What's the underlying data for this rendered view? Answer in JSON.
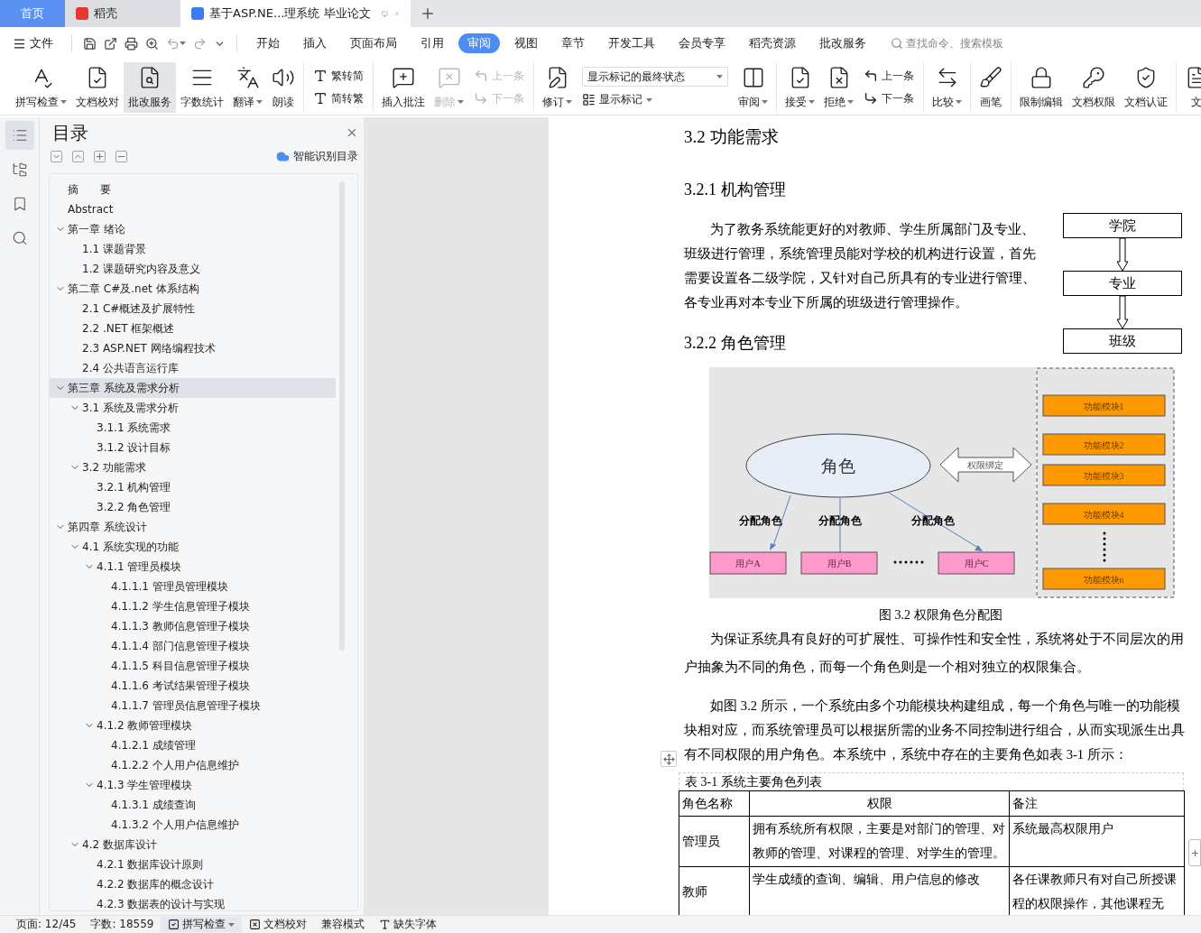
{
  "tabs": [
    {
      "label": "首页",
      "kind": "home",
      "selected": false
    },
    {
      "label": "稻壳",
      "kind": "docer",
      "selected": false
    },
    {
      "label": "基于ASP.NE...理系统 毕业论文",
      "kind": "doc",
      "selected": true
    }
  ],
  "menu": {
    "file": "文件",
    "tabs": [
      {
        "label": "开始",
        "selected": false
      },
      {
        "label": "插入",
        "selected": false
      },
      {
        "label": "页面布局",
        "selected": false
      },
      {
        "label": "引用",
        "selected": false
      },
      {
        "label": "审阅",
        "selected": true
      },
      {
        "label": "视图",
        "selected": false
      },
      {
        "label": "章节",
        "selected": false
      },
      {
        "label": "开发工具",
        "selected": false
      },
      {
        "label": "会员专享",
        "selected": false
      },
      {
        "label": "稻壳资源",
        "selected": false
      },
      {
        "label": "批改服务",
        "selected": false
      }
    ],
    "search": {
      "placeholder": "查找命令、搜索模板"
    }
  },
  "ribbon": [
    {
      "items": [
        {
          "kind": "large",
          "label": "拼写检查",
          "menu": true,
          "disabled": false,
          "active": false
        },
        {
          "kind": "large",
          "label": "文档校对",
          "menu": false,
          "disabled": false,
          "active": false
        },
        {
          "kind": "large",
          "label": "批改服务",
          "menu": false,
          "disabled": false,
          "active": true
        },
        {
          "kind": "large",
          "label": "字数统计",
          "menu": false,
          "disabled": false,
          "active": false
        },
        {
          "kind": "large",
          "label": "翻译",
          "menu": true,
          "disabled": false,
          "active": false
        },
        {
          "kind": "large",
          "label": "朗读",
          "menu": false,
          "disabled": false,
          "active": false
        }
      ]
    },
    {
      "items": [
        {
          "kind": "stack",
          "entries": [
            {
              "label": "繁转简",
              "disabled": false
            },
            {
              "label": "简转繁",
              "disabled": false
            }
          ]
        }
      ]
    },
    {
      "items": [
        {
          "kind": "large",
          "label": "插入批注",
          "menu": false,
          "disabled": false,
          "active": false
        },
        {
          "kind": "large",
          "label": "删除",
          "menu": true,
          "disabled": true,
          "active": false
        },
        {
          "kind": "stack",
          "entries": [
            {
              "label": "上一条",
              "disabled": true
            },
            {
              "label": "下一条",
              "disabled": true
            }
          ]
        }
      ]
    },
    {
      "items": [
        {
          "kind": "large",
          "label": "修订",
          "menu": true,
          "disabled": false,
          "active": false
        },
        {
          "kind": "select",
          "value": "显示标记的最终状态",
          "option": "显示标记"
        },
        {
          "kind": "large",
          "label": "审阅",
          "menu": true,
          "disabled": false,
          "active": false
        }
      ]
    },
    {
      "items": [
        {
          "kind": "large",
          "label": "接受",
          "menu": true,
          "disabled": false,
          "active": false
        },
        {
          "kind": "large",
          "label": "拒绝",
          "menu": true,
          "disabled": false,
          "active": false
        },
        {
          "kind": "stack",
          "entries": [
            {
              "label": "上一条",
              "disabled": false
            },
            {
              "label": "下一条",
              "disabled": false
            }
          ]
        }
      ]
    },
    {
      "items": [
        {
          "kind": "large",
          "label": "比较",
          "menu": true,
          "disabled": false,
          "active": false
        }
      ]
    },
    {
      "items": [
        {
          "kind": "large",
          "label": "画笔",
          "menu": false,
          "disabled": false,
          "active": false
        }
      ]
    },
    {
      "items": [
        {
          "kind": "large",
          "label": "限制编辑",
          "menu": false,
          "disabled": false,
          "active": false
        },
        {
          "kind": "large",
          "label": "文档权限",
          "menu": false,
          "disabled": false,
          "active": false
        },
        {
          "kind": "large",
          "label": "文档认证",
          "menu": false,
          "disabled": false,
          "active": false
        }
      ]
    },
    {
      "items": [
        {
          "kind": "large",
          "label": "文",
          "menu": false,
          "disabled": false,
          "active": false
        }
      ]
    }
  ],
  "rail": [
    {
      "selected": true
    },
    {
      "selected": false
    },
    {
      "selected": false
    },
    {
      "selected": false
    }
  ],
  "toc": {
    "title": "目录",
    "smart": "智能识别目录",
    "items": [
      {
        "label": "摘　　要",
        "selected": false
      },
      {
        "label": "Abstract",
        "selected": false
      },
      {
        "label": "第一章  绪论",
        "selected": false,
        "expanded": true,
        "children": [
          {
            "label": "1.1  课题背景",
            "selected": false
          },
          {
            "label": "1.2  课题研究内容及意义",
            "selected": false
          }
        ]
      },
      {
        "label": "第二章  C#及.net 体系结构",
        "selected": false,
        "expanded": true,
        "children": [
          {
            "label": "2.1 C#概述及扩展特性",
            "selected": false
          },
          {
            "label": "2.2    .NET 框架概述",
            "selected": false
          },
          {
            "label": "2.3 ASP.NET 网络编程技术",
            "selected": false
          },
          {
            "label": "2.4  公共语言运行库",
            "selected": false
          }
        ]
      },
      {
        "label": "第三章  系统及需求分析",
        "selected": true,
        "expanded": true,
        "children": [
          {
            "label": "3.1 系统及需求分析",
            "selected": false,
            "expanded": true,
            "children": [
              {
                "label": "3.1.1  系统需求",
                "selected": false
              },
              {
                "label": "3.1.2  设计目标",
                "selected": false
              }
            ]
          },
          {
            "label": "3.2  功能需求",
            "selected": false,
            "expanded": true,
            "children": [
              {
                "label": "3.2.1  机构管理",
                "selected": false
              },
              {
                "label": "3.2.2  角色管理",
                "selected": false
              }
            ]
          }
        ]
      },
      {
        "label": "第四章    系统设计",
        "selected": false,
        "expanded": true,
        "children": [
          {
            "label": "4.1  系统实现的功能",
            "selected": false,
            "expanded": true,
            "children": [
              {
                "label": "4.1.1 管理员模块",
                "selected": false,
                "expanded": true,
                "children": [
                  {
                    "label": "4.1.1.1 管理员管理模块",
                    "selected": false
                  },
                  {
                    "label": "4.1.1.2  学生信息管理子模块",
                    "selected": false
                  },
                  {
                    "label": "4.1.1.3  教师信息管理子模块",
                    "selected": false
                  },
                  {
                    "label": "4.1.1.4  部门信息管理子模块",
                    "selected": false
                  },
                  {
                    "label": "4.1.1.5  科目信息管理子模块",
                    "selected": false
                  },
                  {
                    "label": "4.1.1.6  考试结果管理子模块",
                    "selected": false
                  },
                  {
                    "label": "4.1.1.7  管理员信息管理子模块",
                    "selected": false
                  }
                ]
              },
              {
                "label": "4.1.2  教师管理模块",
                "selected": false,
                "expanded": true,
                "children": [
                  {
                    "label": "4.1.2.1  成绩管理",
                    "selected": false
                  },
                  {
                    "label": "4.1.2.2 个人用户信息维护",
                    "selected": false
                  }
                ]
              },
              {
                "label": "4.1.3  学生管理模块",
                "selected": false,
                "expanded": true,
                "children": [
                  {
                    "label": "4.1.3.1  成绩查询",
                    "selected": false
                  },
                  {
                    "label": "4.1.3.2 个人用户信息维护",
                    "selected": false
                  }
                ]
              }
            ]
          },
          {
            "label": "4.2  数据库设计",
            "selected": false,
            "expanded": true,
            "children": [
              {
                "label": "4.2.1    数据库设计原则",
                "selected": false
              },
              {
                "label": "4.2.2  数据库的概念设计",
                "selected": false
              },
              {
                "label": "4.2.3  数据表的设计与实现",
                "selected": false
              }
            ]
          }
        ]
      }
    ]
  },
  "document": {
    "section": "3.2  功能需求",
    "sub1": "3.2.1  机构管理",
    "para1": "为了教务系统能更好的对教师、学生所属部门及专业、班级进行管理，系统管理员能对学校的机构进行设置，首先需要设置各二级学院，又针对自己所具有的专业进行管理、各专业再对本专业下所属的班级进行管理操作。",
    "flow": [
      "学院",
      "专业",
      "班级"
    ],
    "sub2": "3.2.2  角色管理",
    "figure": {
      "role": "角色",
      "binding": "权限绑定",
      "assign": [
        "分配角色",
        "分配角色",
        "分配角色"
      ],
      "users": [
        "用户A",
        "用户B",
        "用户C"
      ],
      "modules": [
        "功能模块1",
        "功能模块2",
        "功能模块3",
        "功能模块4",
        "功能模块n"
      ]
    },
    "caption": "图 3.2  权限角色分配图",
    "para2": "为保证系统具有良好的可扩展性、可操作性和安全性，系统将处于不同层次的用户抽象为不同的角色，而每一个角色则是一个相对独立的权限集合。",
    "para3": "如图 3.2 所示，一个系统由多个功能模块构建组成，每一个角色与唯一的功能模块相对应，而系统管理员可以根据所需的业务不同控制进行组合，从而实现派生出具有不同权限的用户角色。本系统中，系统中存在的主要角色如表 3-1 所示：",
    "table": {
      "caption": "表 3-1  系统主要角色列表",
      "columns": [
        "角色名称",
        "权限",
        "备注"
      ],
      "rows": [
        [
          "管理员",
          "拥有系统所有权限，主要是对部门的管理、对教师的管理、对课程的管理、对学生的管理。",
          "系统最高权限用户"
        ],
        [
          "教师",
          "学生成绩的查询、编辑、用户信息的修改",
          "各任课教师只有对自己所授课程的权限操作，其他课程无"
        ]
      ]
    }
  },
  "status_bar": {
    "page": "页面: 12/45",
    "words": "字数: 18559",
    "spell": "拼写检查",
    "proof": "文档校对",
    "mode": "兼容模式",
    "fonts": "缺失字体"
  }
}
